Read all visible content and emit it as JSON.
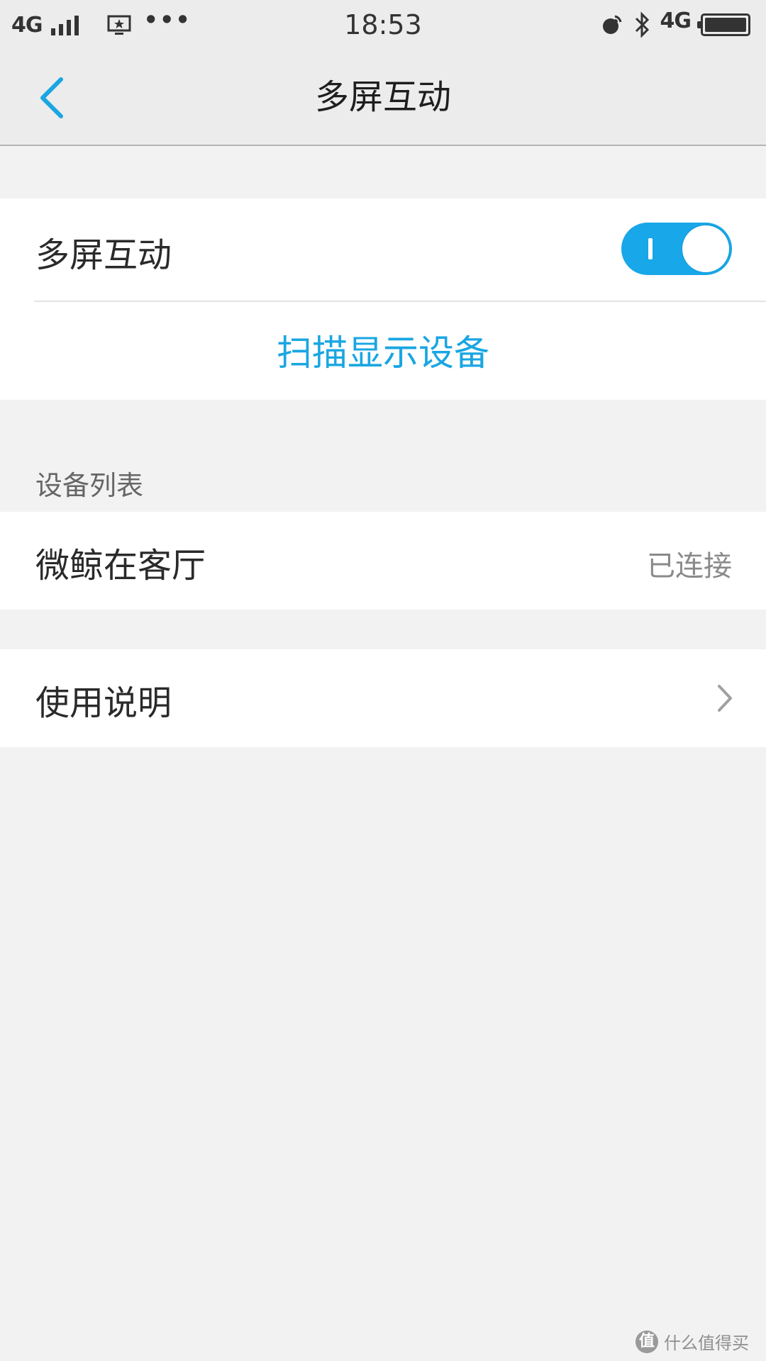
{
  "status_bar": {
    "network_left": "4G",
    "time": "18:53",
    "network_right": "4G",
    "icons": [
      "signal-icon",
      "screen-cast-icon",
      "more-dots-icon",
      "nfc-icon",
      "bluetooth-icon",
      "battery-icon"
    ],
    "more_glyph": "•••"
  },
  "nav": {
    "title": "多屏互动",
    "back_icon": "chevron-left-icon"
  },
  "toggle_section": {
    "label": "多屏互动",
    "enabled": true,
    "scan_label": "扫描显示设备"
  },
  "device_section": {
    "header": "设备列表",
    "devices": [
      {
        "name": "微鲸在客厅",
        "status": "已连接"
      }
    ]
  },
  "help": {
    "label": "使用说明",
    "icon": "chevron-right-icon"
  },
  "watermark": {
    "logo_text": "值",
    "text": "什么值得买"
  },
  "colors": {
    "accent": "#18a7e8",
    "page_background": "#f2f2f2",
    "card_background": "#ffffff"
  }
}
